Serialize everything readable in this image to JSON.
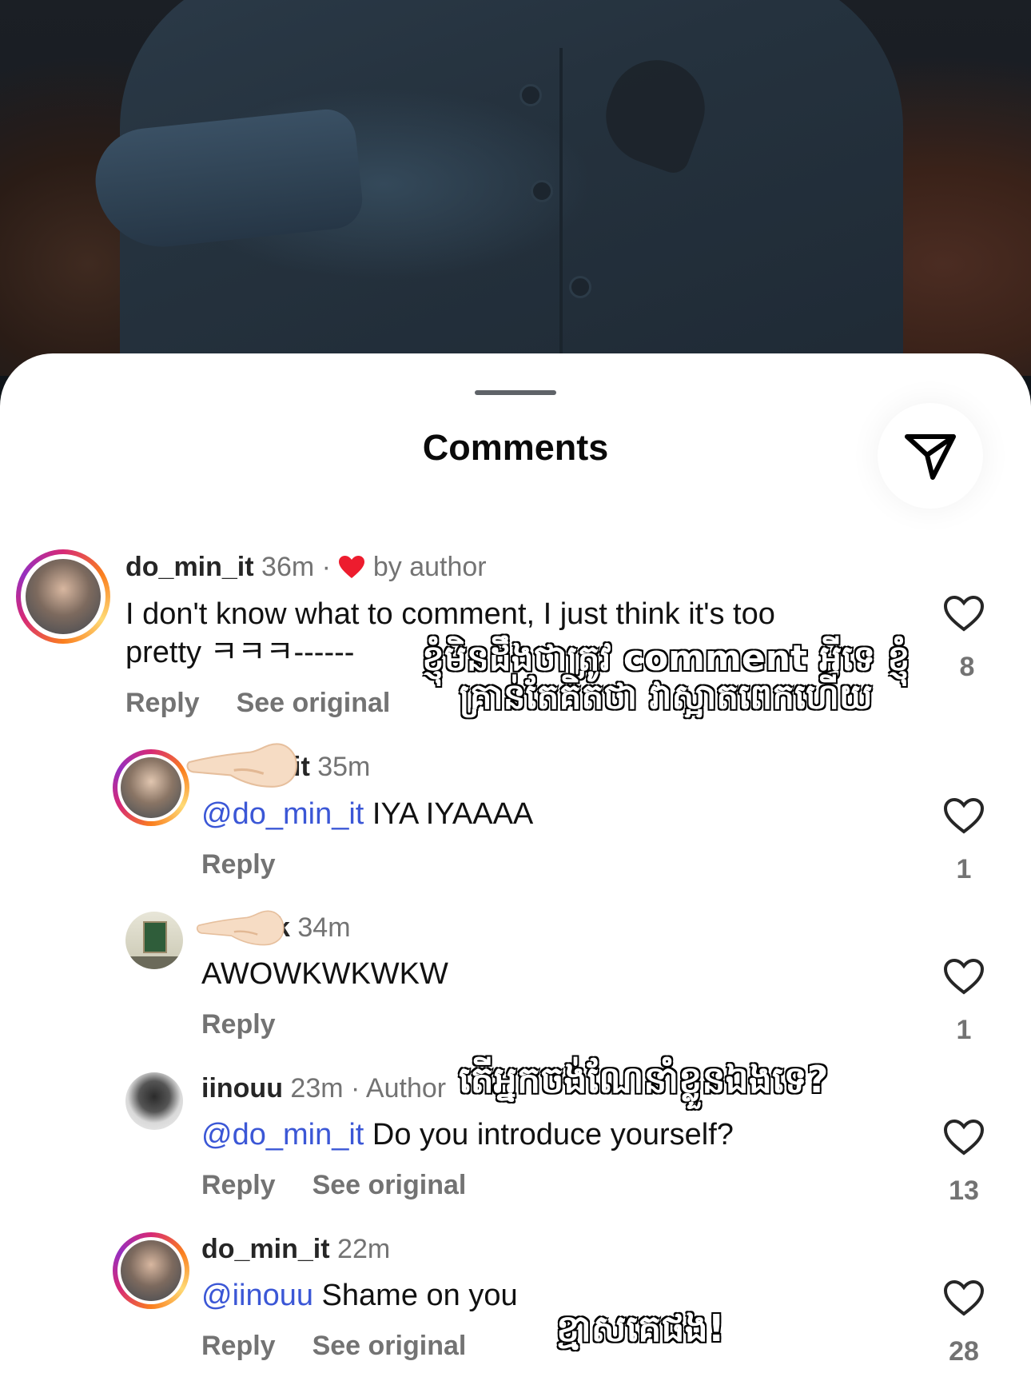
{
  "sheet": {
    "title": "Comments"
  },
  "comments": [
    {
      "username": "do_min_it",
      "time": "36m",
      "liked_by": "by author",
      "text_line1": "I don't know what to comment, I just think it's too",
      "text_line2": "pretty ㅋㅋㅋ------",
      "reply": "Reply",
      "see_original": "See original",
      "likes": "8",
      "overlay_line1": "ខ្ញុំមិនដឹងថាត្រូវ comment អ្វីទេ ខ្ញុំ",
      "overlay_line2": "គ្រាន់តែគិតថា វាស្អាតពេកហើយ"
    },
    {
      "username_partial": "it",
      "time": "35m",
      "mention": "@do_min_it",
      "text": " IYA IYAAAA",
      "reply": "Reply",
      "likes": "1"
    },
    {
      "username_partial": "k",
      "time": "34m",
      "text": "AWOWKWKWKW",
      "reply": "Reply",
      "likes": "1"
    },
    {
      "username": "iinouu",
      "time": "23m",
      "author_tag": "Author",
      "mention": "@do_min_it",
      "text": " Do you introduce yourself?",
      "reply": "Reply",
      "see_original": "See original",
      "likes": "13",
      "overlay": "តើអ្នកចង់ណែនាំខ្លួនឯងទេ?"
    },
    {
      "username": "do_min_it",
      "time": "22m",
      "mention": "@iinouu",
      "text": " Shame on you",
      "reply": "Reply",
      "see_original": "See original",
      "likes": "28",
      "overlay": "ខ្មាសគេផង!"
    }
  ],
  "icons": {
    "send": "send-icon",
    "like": "heart-outline-icon",
    "liked": "red-heart-icon",
    "hand": "pointing-hand-emoji"
  },
  "colors": {
    "mention": "#3b57d6",
    "heart": "#ed1c2e",
    "muted": "#737373"
  }
}
